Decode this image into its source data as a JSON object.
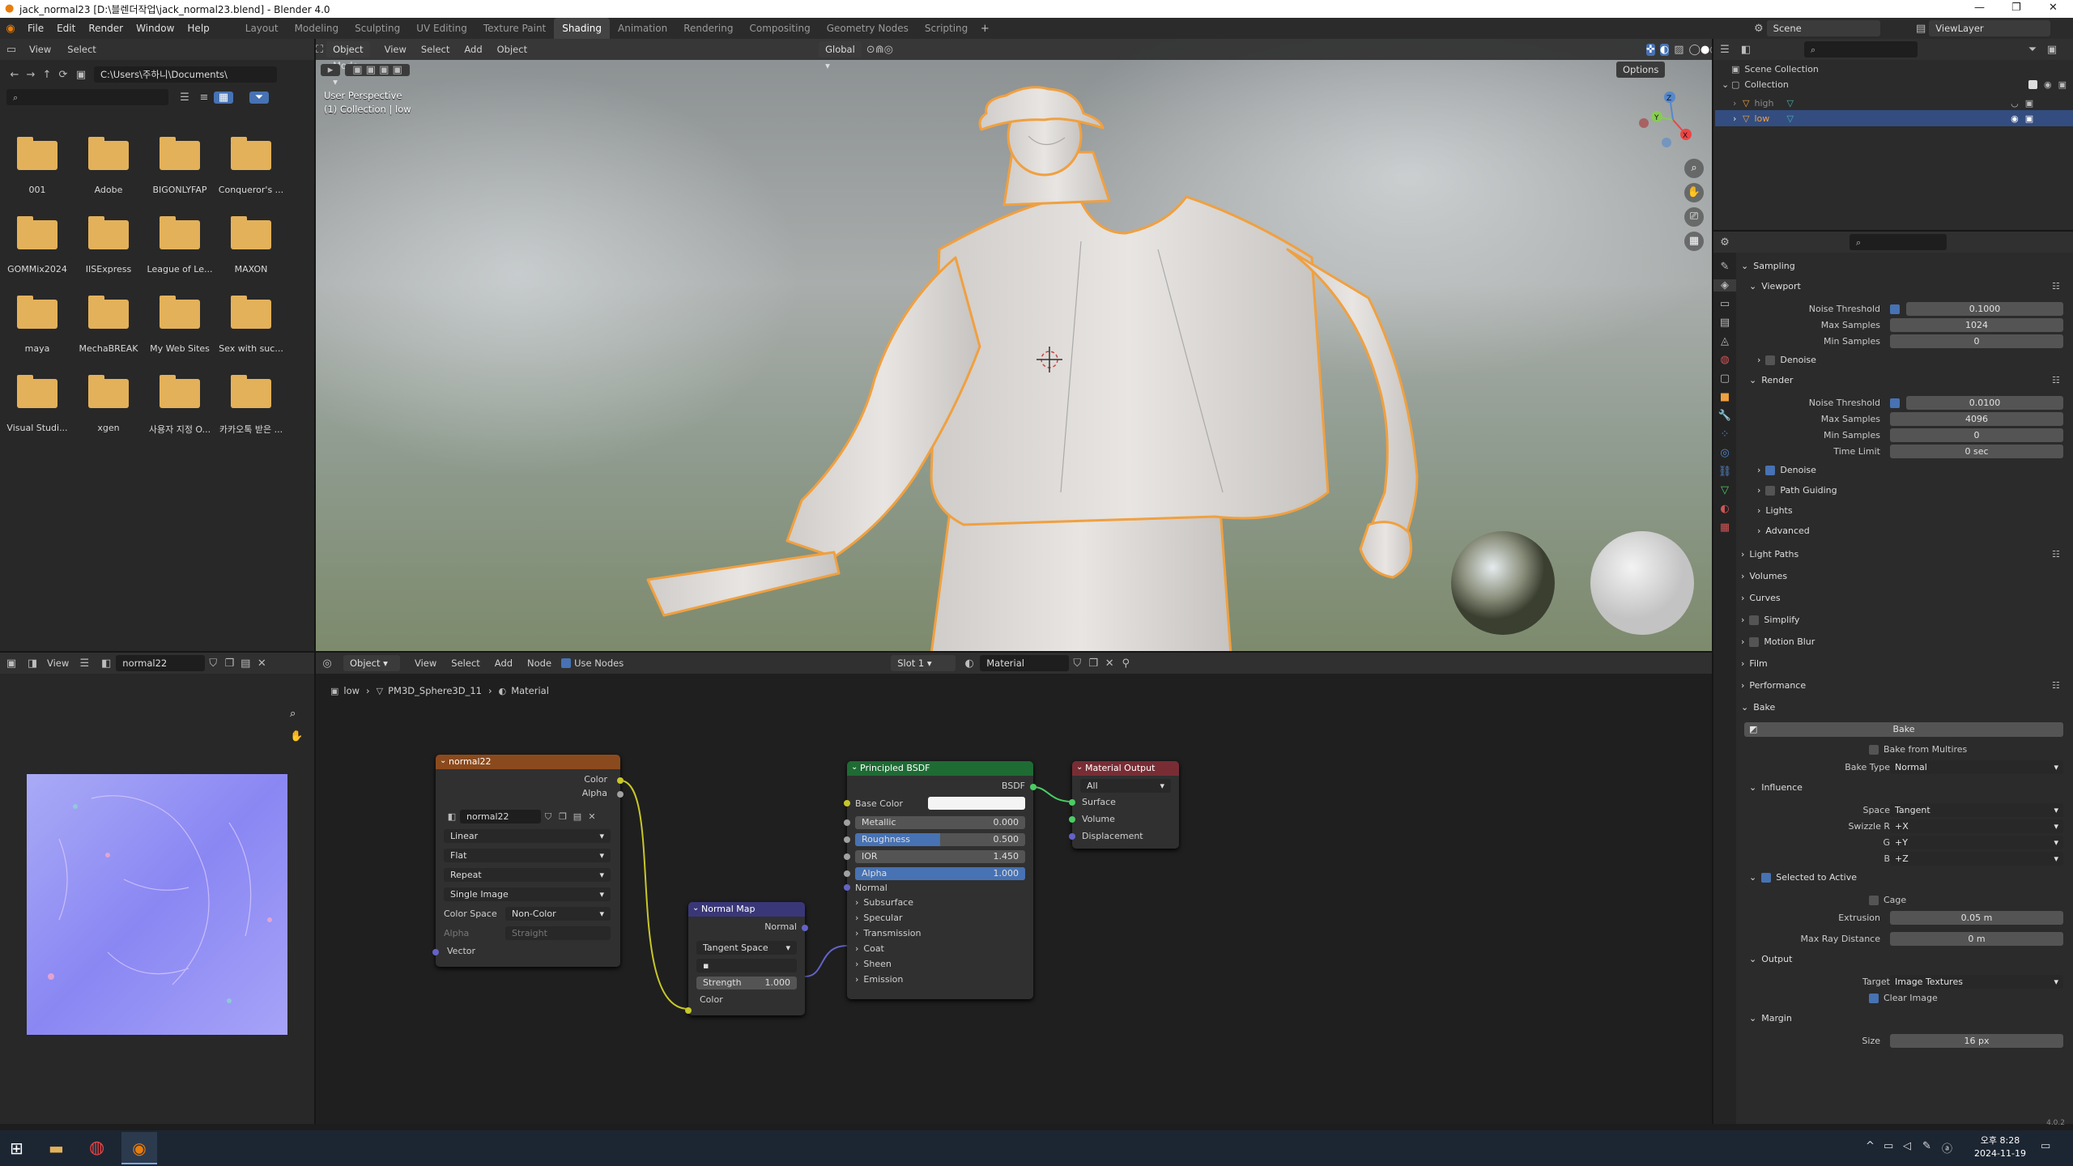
{
  "window": {
    "title": "jack_normal23 [D:\\블렌더작업\\jack_normal23.blend] - Blender 4.0"
  },
  "menu": [
    "File",
    "Edit",
    "Render",
    "Window",
    "Help"
  ],
  "workspaces": [
    "Layout",
    "Modeling",
    "Sculpting",
    "UV Editing",
    "Texture Paint",
    "Shading",
    "Animation",
    "Rendering",
    "Compositing",
    "Geometry Nodes",
    "Scripting"
  ],
  "active_workspace": "Shading",
  "scene": {
    "name": "Scene",
    "view_layer": "ViewLayer"
  },
  "file_browser": {
    "header": {
      "view": "View",
      "select": "Select"
    },
    "path": "C:\\Users\\주하니\\Documents\\",
    "folders": [
      "001",
      "Adobe",
      "BIGONLYFAP",
      "Conqueror's ...",
      "GOMMix2024",
      "IISExpress",
      "League of Le...",
      "MAXON",
      "maya",
      "MechaBREAK",
      "My Web Sites",
      "Sex with suc...",
      "Visual Studi...",
      "xgen",
      "사용자 지정 O...",
      "카카오톡 받은 ..."
    ]
  },
  "viewport": {
    "mode": "Object Mode",
    "menus": [
      "View",
      "Select",
      "Add",
      "Object"
    ],
    "orientation": "Global",
    "options": "Options",
    "overlay_title": "User Perspective",
    "overlay_sub": "(1) Collection | low",
    "gizmo": {
      "x": "X",
      "y": "Y",
      "z": "Z"
    }
  },
  "image_editor": {
    "view": "View",
    "image_name": "normal22"
  },
  "node_editor": {
    "object_mode": "Object",
    "menus": [
      "View",
      "Select",
      "Add",
      "Node"
    ],
    "use_nodes": "Use Nodes",
    "slot": "Slot 1",
    "material": "Material",
    "breadcrumb": [
      "low",
      "PM3D_Sphere3D_11",
      "Material"
    ],
    "image_node": {
      "title": "normal22",
      "out_color": "Color",
      "out_alpha": "Alpha",
      "image": "normal22",
      "interp": "Linear",
      "projection": "Flat",
      "extension": "Repeat",
      "source": "Single Image",
      "cs_label": "Color Space",
      "color_space": "Non-Color",
      "alpha_label": "Alpha",
      "alpha_mode": "Straight",
      "vector": "Vector"
    },
    "normal_map_node": {
      "title": "Normal Map",
      "out": "Normal",
      "space": "Tangent Space",
      "strength_label": "Strength",
      "strength": "1.000",
      "color": "Color"
    },
    "bsdf_node": {
      "title": "Principled BSDF",
      "out": "BSDF",
      "base_color": "Base Color",
      "fields": [
        {
          "label": "Metallic",
          "value": "0.000",
          "fill": 0
        },
        {
          "label": "Roughness",
          "value": "0.500",
          "fill": 0.5
        },
        {
          "label": "IOR",
          "value": "1.450",
          "fill": 0
        },
        {
          "label": "Alpha",
          "value": "1.000",
          "fill": 1
        }
      ],
      "normal": "Normal",
      "panels": [
        "Subsurface",
        "Specular",
        "Transmission",
        "Coat",
        "Sheen",
        "Emission"
      ]
    },
    "output_node": {
      "title": "Material Output",
      "target": "All",
      "inputs": [
        "Surface",
        "Volume",
        "Displacement"
      ]
    }
  },
  "outliner": {
    "root": "Scene Collection",
    "collection": "Collection",
    "items": [
      "high",
      "low"
    ]
  },
  "properties": {
    "sampling": "Sampling",
    "viewport": "Viewport",
    "vp_rows": [
      {
        "label": "Noise Threshold",
        "value": "0.1000",
        "check": true
      },
      {
        "label": "Max Samples",
        "value": "1024"
      },
      {
        "label": "Min Samples",
        "value": "0"
      }
    ],
    "denoise": "Denoise",
    "render": "Render",
    "r_rows": [
      {
        "label": "Noise Threshold",
        "value": "0.0100",
        "check": true
      },
      {
        "label": "Max Samples",
        "value": "4096"
      },
      {
        "label": "Min Samples",
        "value": "0"
      },
      {
        "label": "Time Limit",
        "value": "0 sec"
      }
    ],
    "r_sub": [
      "Denoise",
      "Path Guiding",
      "Lights",
      "Advanced"
    ],
    "sections": [
      "Light Paths",
      "Volumes",
      "Curves",
      "Simplify",
      "Motion Blur",
      "Film",
      "Performance"
    ],
    "bake": {
      "title": "Bake",
      "button": "Bake",
      "from_multires": "Bake from Multires",
      "type_label": "Bake Type",
      "type": "Normal",
      "influence": "Influence",
      "space_label": "Space",
      "space": "Tangent",
      "swizzle_r_label": "Swizzle R",
      "swizzle_r": "+X",
      "g_label": "G",
      "g": "+Y",
      "b_label": "B",
      "b": "+Z",
      "sel_to_active": "Selected to Active",
      "cage": "Cage",
      "extrusion_label": "Extrusion",
      "extrusion": "0.05 m",
      "max_ray_label": "Max Ray Distance",
      "max_ray": "0 m",
      "output": "Output",
      "target_label": "Target",
      "target": "Image Textures",
      "clear_image": "Clear Image",
      "margin": "Margin",
      "size_label": "Size",
      "size": "16 px"
    }
  },
  "status": {
    "version": "4.0.2"
  },
  "taskbar": {
    "ampm_time": "오후 8:28",
    "date": "2024-11-19"
  }
}
